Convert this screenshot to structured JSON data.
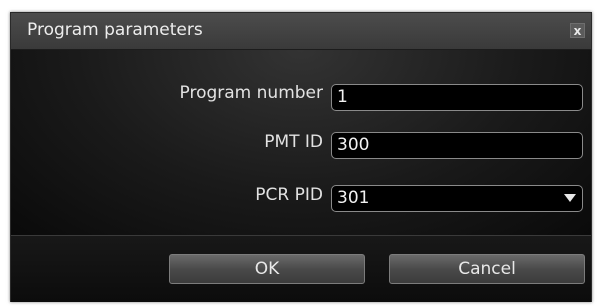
{
  "window": {
    "title": "Program parameters",
    "close_glyph": "x"
  },
  "form": {
    "program_number": {
      "label": "Program number",
      "value": "1"
    },
    "pmt_id": {
      "label": "PMT ID",
      "value": "300"
    },
    "pcr_pid": {
      "label": "PCR PID",
      "value": "301"
    }
  },
  "buttons": {
    "ok_label": "OK",
    "cancel_label": "Cancel"
  }
}
